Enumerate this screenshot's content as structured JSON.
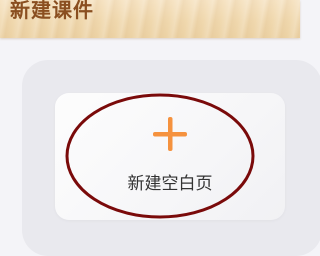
{
  "header": {
    "title": "新建课件"
  },
  "card": {
    "label": "新建空白页",
    "icon": "plus-icon"
  },
  "colors": {
    "header_title": "#8a4f20",
    "plus_icon": "#f5923e",
    "highlight_ellipse": "#7a0a0a",
    "panel_bg": "#e9e9ee",
    "page_bg": "#f4f4f8"
  }
}
